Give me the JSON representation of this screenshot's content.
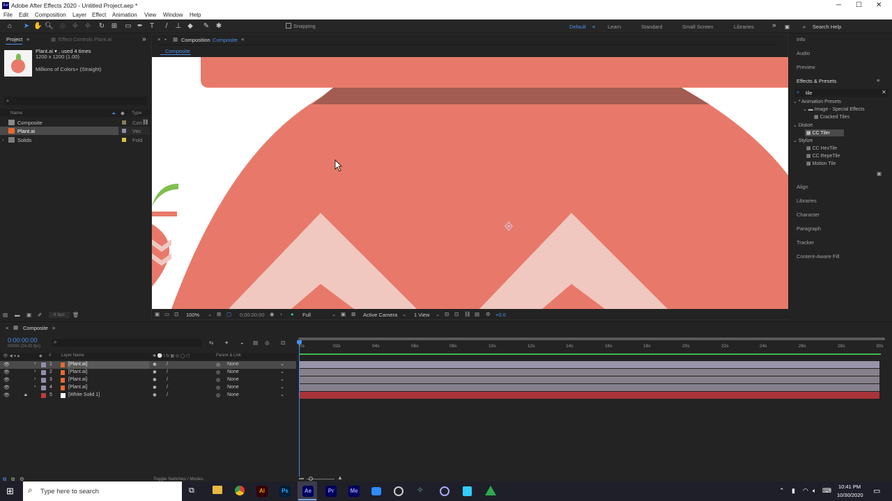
{
  "app": {
    "title": "Adobe After Effects 2020 - Untitled Project.aep *",
    "logo": "Ae",
    "min": "─",
    "max": "☐",
    "close": "✕"
  },
  "menu": [
    "File",
    "Edit",
    "Composition",
    "Layer",
    "Effect",
    "Animation",
    "View",
    "Window",
    "Help"
  ],
  "toolbar": {
    "snapping": "Snapping",
    "workspaces": [
      "Default",
      "Learn",
      "Standard",
      "Small Screen",
      "Libraries"
    ],
    "more": "»",
    "search_help": "Search Help"
  },
  "project": {
    "tab": "Project",
    "effect_controls_tab": "Effect Controls Plant.ai",
    "selected_name": "Plant.ai ▾ , used 4 times",
    "selected_dims": "1200 x 1200 (1.00)",
    "selected_color": "Millions of Colors+ (Straight)",
    "col_name": "Name",
    "col_type": "Type",
    "items": [
      {
        "name": "Composite",
        "type": "Con",
        "color": "#8a7a5a"
      },
      {
        "name": "Plant.ai",
        "type": "Vec",
        "color": "#8f8faa"
      },
      {
        "name": "Solids",
        "type": "Fold",
        "color": "#d8c040"
      }
    ],
    "bpc": "8 bpc"
  },
  "composition": {
    "tab_prefix": "Composition",
    "tab_name": "Composite",
    "subtab": "Composite",
    "zoom": "100%",
    "timecode": "0:00:00:00",
    "resolution": "Full",
    "camera": "Active Camera",
    "views": "1 View",
    "exposure": "+0.0"
  },
  "right_panel": {
    "items_top": [
      "Info",
      "Audio",
      "Preview"
    ],
    "effects_title": "Effects & Presets",
    "search_value": "tile",
    "tree": [
      "* Animation Presets",
      "Image - Special Effects",
      "Cracked Tiles",
      "Distort",
      "CC Tiler",
      "Stylize",
      "CC HexTile",
      "CC RepeTile",
      "Motion Tile"
    ],
    "items_bottom": [
      "Align",
      "Libraries",
      "Character",
      "Paragraph",
      "Tracker",
      "Content-Aware Fill"
    ]
  },
  "timeline": {
    "tab": "Composite",
    "timecode": "0:00:00:00",
    "frames": "00000 (24.00 fps)",
    "col_layer": "Layer Name",
    "col_parent": "Parent & Link",
    "ruler": [
      "0s",
      "02s",
      "04s",
      "06s",
      "08s",
      "10s",
      "12s",
      "14s",
      "16s",
      "18s",
      "20s",
      "22s",
      "24s",
      "26s",
      "28s",
      "30s"
    ],
    "layers": [
      {
        "num": "1",
        "name": "[Plant.ai]",
        "parent": "None"
      },
      {
        "num": "2",
        "name": "[Plant.ai]",
        "parent": "None"
      },
      {
        "num": "3",
        "name": "[Plant.ai]",
        "parent": "None"
      },
      {
        "num": "4",
        "name": "[Plant.ai]",
        "parent": "None"
      },
      {
        "num": "5",
        "name": "[White Solid 1]",
        "parent": "None"
      }
    ],
    "toggle": "Toggle Switches / Modes"
  },
  "taskbar": {
    "search": "Type here to search",
    "time": "10:41 PM",
    "date": "10/30/2020",
    "apps": [
      "Ai",
      "Ps",
      "Ae",
      "Pr",
      "Me"
    ]
  }
}
